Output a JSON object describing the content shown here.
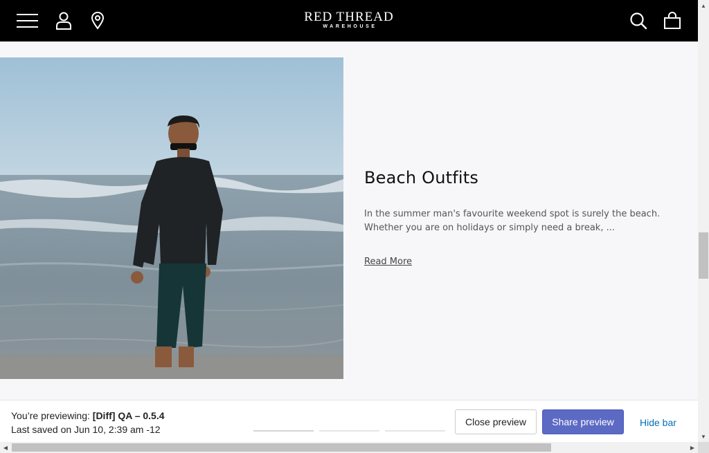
{
  "header": {
    "logo_main": "RED THREAD",
    "logo_sub": "WAREHOUSE",
    "icons": [
      "menu-icon",
      "account-icon",
      "store-location-icon",
      "search-icon",
      "cart-icon"
    ]
  },
  "article": {
    "image": "man-walking-on-beach-photo",
    "title": "Beach Outfits",
    "excerpt": "In the summer man's favourite weekend spot is surely the beach. Whether you are on holidays or simply need a break, ...",
    "read_more": "Read More"
  },
  "preview_bar": {
    "previewing_label": "You’re previewing:",
    "theme_name": "[Diff] QA – 0.5.4",
    "last_saved": "Last saved on Jun 10, 2:39 am -12",
    "close_label": "Close preview",
    "share_label": "Share preview",
    "hide_label": "Hide bar"
  },
  "colors": {
    "header_bg": "#000000",
    "page_bg": "#f7f7fa",
    "share_button": "#5c6ac4",
    "link_blue": "#006fbb"
  }
}
